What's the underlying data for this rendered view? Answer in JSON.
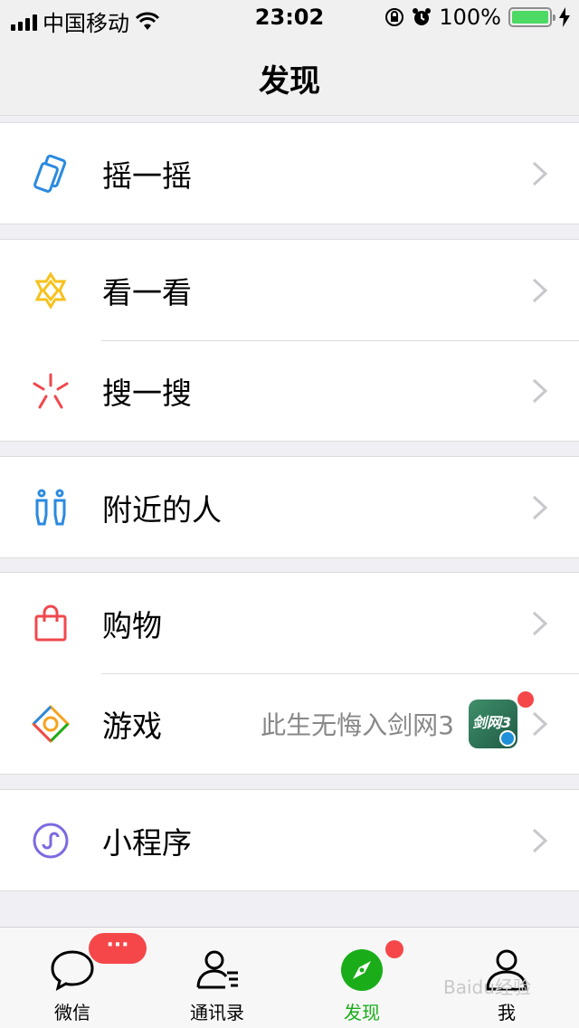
{
  "status_bar": {
    "carrier": "中国移动",
    "time": "23:02",
    "battery": "100%"
  },
  "nav": {
    "title": "发现"
  },
  "groups": [
    {
      "items": [
        {
          "label": "摇一摇",
          "icon": "shake-icon"
        }
      ]
    },
    {
      "items": [
        {
          "label": "看一看",
          "icon": "top-stories-icon"
        },
        {
          "label": "搜一搜",
          "icon": "search-flower-icon"
        }
      ]
    },
    {
      "items": [
        {
          "label": "附近的人",
          "icon": "people-nearby-icon"
        }
      ]
    },
    {
      "items": [
        {
          "label": "购物",
          "icon": "shopping-bag-icon"
        },
        {
          "label": "游戏",
          "icon": "games-icon",
          "extra": "此生无悔入剑网3",
          "thumbnail_text": "剑网3"
        }
      ]
    },
    {
      "items": [
        {
          "label": "小程序",
          "icon": "mini-program-icon"
        }
      ]
    }
  ],
  "tabs": [
    {
      "label": "微信",
      "icon": "chat-icon",
      "badge": "···"
    },
    {
      "label": "通讯录",
      "icon": "contacts-icon"
    },
    {
      "label": "发现",
      "icon": "discover-compass-icon",
      "active": true
    },
    {
      "label": "我",
      "icon": "me-icon"
    }
  ],
  "colors": {
    "accent_green": "#1aad19",
    "badge_red": "#f5474a",
    "battery_green": "#4cd964"
  },
  "watermark": "Baidu经验"
}
